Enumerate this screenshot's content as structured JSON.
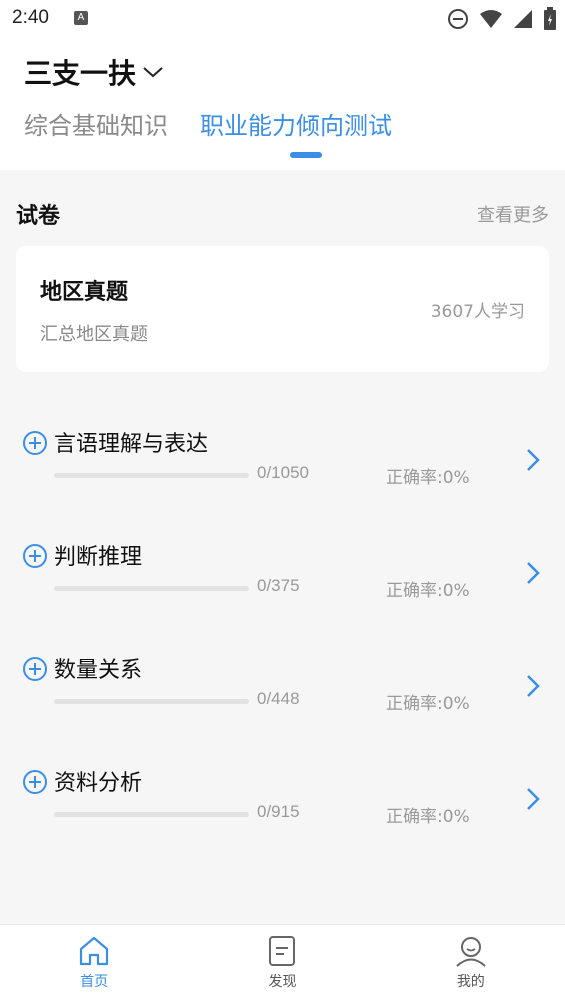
{
  "status_bar": {
    "time": "2:40",
    "notification_letter": "A"
  },
  "header": {
    "title": "三支一扶",
    "tabs": [
      {
        "label": "综合基础知识",
        "active": false
      },
      {
        "label": "职业能力倾向测试",
        "active": true
      }
    ]
  },
  "papers": {
    "title": "试卷",
    "more": "查看更多",
    "card": {
      "title": "地区真题",
      "subtitle": "汇总地区真题",
      "count": "3607人学习"
    }
  },
  "categories": [
    {
      "title": "言语理解与表达",
      "progress": "0/1050",
      "accuracy": "正确率:0%",
      "progress_fraction": 0
    },
    {
      "title": "判断推理",
      "progress": "0/375",
      "accuracy": "正确率:0%",
      "progress_fraction": 0
    },
    {
      "title": "数量关系",
      "progress": "0/448",
      "accuracy": "正确率:0%",
      "progress_fraction": 0
    },
    {
      "title": "资料分析",
      "progress": "0/915",
      "accuracy": "正确率:0%",
      "progress_fraction": 0
    }
  ],
  "bottom_nav": [
    {
      "label": "首页",
      "icon": "home-icon",
      "active": true
    },
    {
      "label": "发现",
      "icon": "document-icon",
      "active": false
    },
    {
      "label": "我的",
      "icon": "profile-icon",
      "active": false
    }
  ],
  "colors": {
    "accent": "#3a8ee6",
    "background": "#f6f6f6",
    "card": "#ffffff"
  }
}
